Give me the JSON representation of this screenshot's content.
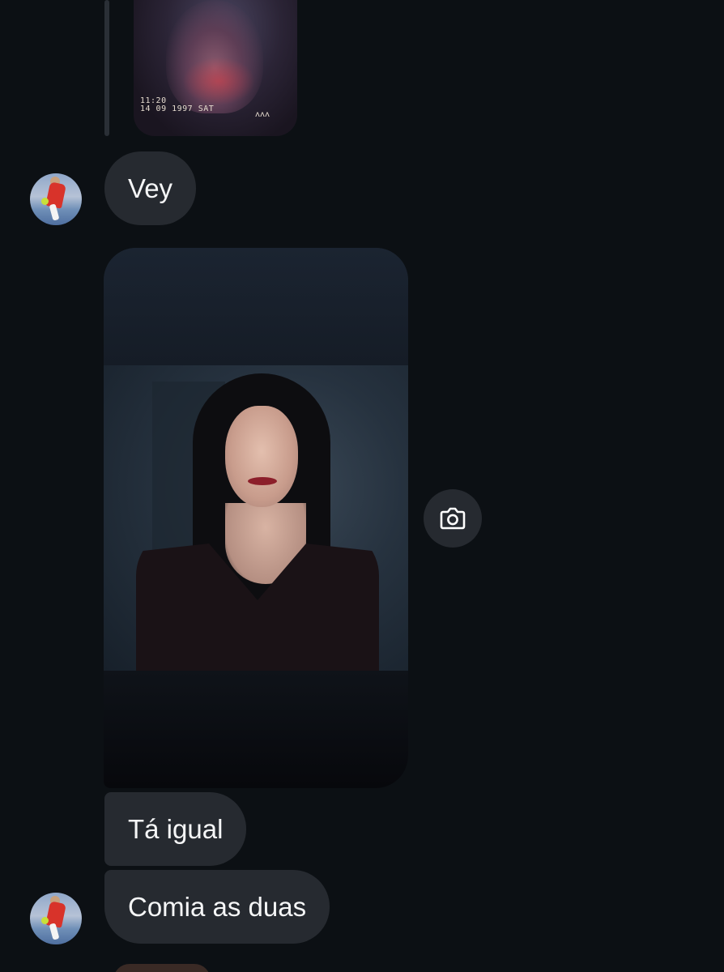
{
  "conversation": {
    "shared_photo_top": {
      "timestamp_line1": "11:20",
      "timestamp_line2": "14 09 1997 SAT",
      "marks": "ᴧᴧᴧ"
    },
    "messages": [
      {
        "type": "text",
        "text": "Vey",
        "has_avatar": true
      },
      {
        "type": "photo",
        "action_icon": "camera-icon"
      },
      {
        "type": "text",
        "text": "Tá igual",
        "has_avatar": false
      },
      {
        "type": "text",
        "text": "Comia as duas",
        "has_avatar": true
      }
    ]
  },
  "colors": {
    "background": "#0c1014",
    "bubble": "#262a30",
    "text": "#f5f6f7"
  }
}
